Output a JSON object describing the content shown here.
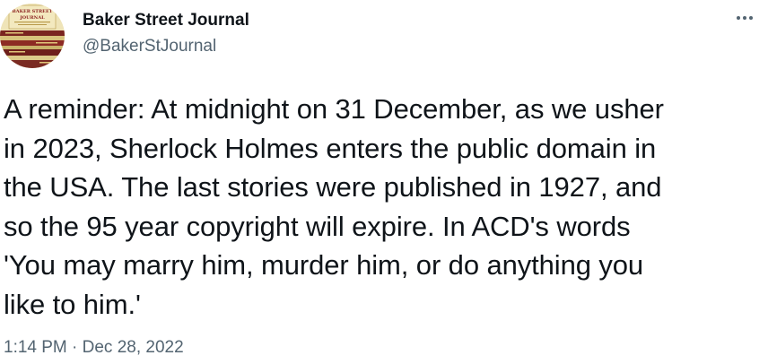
{
  "author": {
    "display_name": "Baker Street Journal",
    "handle": "@BakerStJournal",
    "avatar_text": "BAKER STREET JOURNAL"
  },
  "icons": {
    "more": "more-horizontal-icon"
  },
  "tweet": {
    "text": "A reminder: At midnight on 31 December, as we usher\nin 2023, Sherlock Holmes enters the public domain in\nthe USA. The last stories were published in 1927, and\nso the 95 year copyright will expire. In ACD's words\n'You may marry him, murder him, or do anything you\nlike to him.'",
    "timestamp": "1:14 PM · Dec 28, 2022"
  },
  "colors": {
    "primary_text": "#0f1419",
    "secondary_text": "#536471",
    "background": "#ffffff"
  }
}
